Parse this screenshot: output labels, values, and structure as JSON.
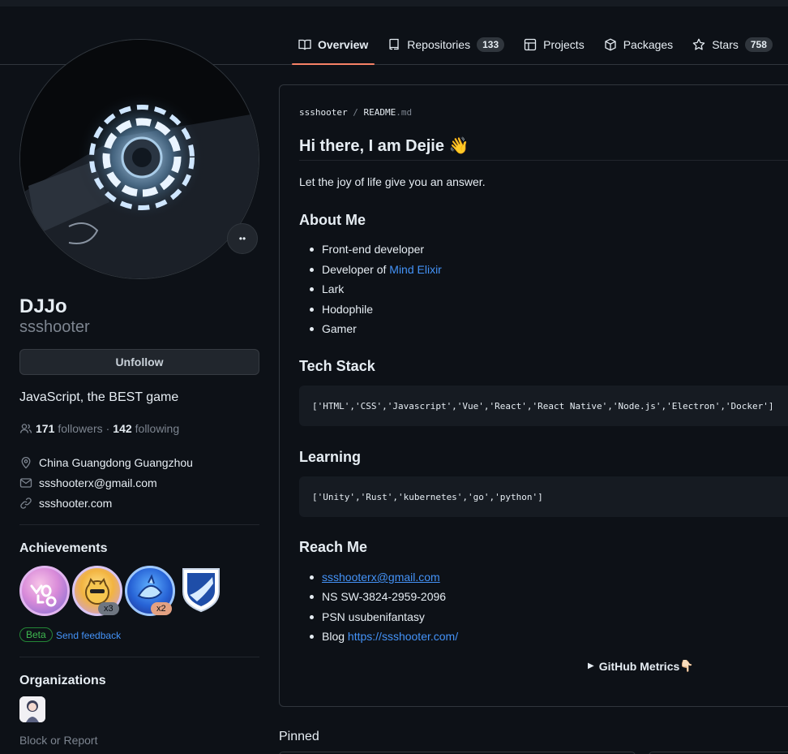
{
  "tabs": [
    {
      "label": "Overview",
      "icon": "book-icon",
      "active": true
    },
    {
      "label": "Repositories",
      "icon": "repo-icon",
      "count": "133"
    },
    {
      "label": "Projects",
      "icon": "table-icon"
    },
    {
      "label": "Packages",
      "icon": "package-icon"
    },
    {
      "label": "Stars",
      "icon": "star-icon",
      "count": "758"
    }
  ],
  "profile": {
    "status_emoji": "••",
    "name": "DJJo",
    "login": "ssshooter",
    "button": "Unfollow",
    "bio": "JavaScript, the BEST game",
    "followers_count": "171",
    "followers_label": "followers",
    "separator": "·",
    "following_count": "142",
    "following_label": "following",
    "location": "China Guangdong Guangzhou",
    "email": "ssshooterx@gmail.com",
    "website": "ssshooter.com"
  },
  "achievements": {
    "title": "Achievements",
    "badges": [
      {
        "name": "yolo",
        "count": ""
      },
      {
        "name": "quickdraw",
        "count": "x3"
      },
      {
        "name": "pull-shark",
        "count": "x2"
      },
      {
        "name": "arctic-code-vault",
        "count": ""
      }
    ],
    "beta": "Beta",
    "feedback": "Send feedback"
  },
  "organizations": {
    "title": "Organizations"
  },
  "block_report": "Block or Report",
  "readme": {
    "crumb_user": "ssshooter",
    "crumb_sep": " / ",
    "crumb_file": "README",
    "crumb_ext": ".md",
    "heading": "Hi there, I am Dejie",
    "heading_emoji": "👋",
    "tagline": "Let the joy of life give you an answer.",
    "about_title": "About Me",
    "about": [
      "Front-end developer",
      "Developer of ",
      "Lark",
      "Hodophile",
      "Gamer"
    ],
    "about_link": "Mind Elixir",
    "tech_title": "Tech Stack",
    "tech_code": "['HTML','CSS','Javascript','Vue','React','React Native','Node.js','Electron','Docker']",
    "learning_title": "Learning",
    "learning_code": "['Unity','Rust','kubernetes','go','python']",
    "reach_title": "Reach Me",
    "reach_email": "ssshooterx@gmail.com",
    "reach_ns": "NS SW-3824-2959-2096",
    "reach_psn": "PSN usubenifantasy",
    "reach_blog_label": "Blog ",
    "reach_blog_link": "https://ssshooter.com/",
    "metrics": "GitHub Metrics",
    "metrics_emoji": "👇🏻"
  },
  "pinned_title": "Pinned"
}
